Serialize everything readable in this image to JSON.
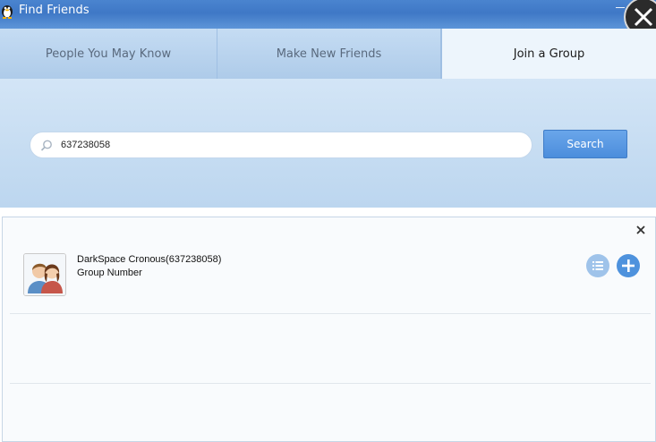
{
  "window": {
    "title": "Find Friends",
    "app_icon": "penguin-icon",
    "close_icon": "close-icon",
    "minimize_icon": "minimize-icon"
  },
  "tabs": [
    {
      "label": "People You May Know",
      "active": false
    },
    {
      "label": "Make New Friends",
      "active": false
    },
    {
      "label": "Join a Group",
      "active": true
    }
  ],
  "search": {
    "value": "637238058",
    "icon": "search-icon",
    "button_label": "Search"
  },
  "results": {
    "close_icon": "close-icon",
    "items": [
      {
        "name": "DarkSpace Cronous(637238058)",
        "subtitle": "Group Number",
        "avatar": "group-avatar-icon",
        "actions": [
          "details-icon",
          "add-icon"
        ]
      }
    ]
  },
  "colors": {
    "titlebar": "#4a84cf",
    "accent": "#4b8ddc",
    "panel": "#c8dff4"
  }
}
